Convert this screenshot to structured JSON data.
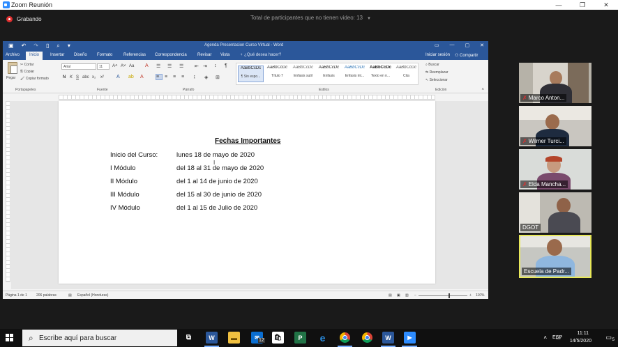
{
  "zoom": {
    "window_title": "Zoom Reunión",
    "recording_label": "Grabando",
    "participants_notice": "Total de participantes que no tienen video: 13",
    "controls": {
      "minimize": "—",
      "restore": "❐",
      "close": "✕"
    }
  },
  "word": {
    "title": "Agenda Presentacion Curso Virtual - Word",
    "tabs": [
      "Archivo",
      "Inicio",
      "Insertar",
      "Diseño",
      "Formato",
      "Referencias",
      "Correspondencia",
      "Revisar",
      "Vista"
    ],
    "active_tab": "Inicio",
    "tell_me": "¿Qué desea hacer?",
    "sign_in": "Iniciar sesión",
    "share": "Compartir",
    "ribbon": {
      "paste": "Pegar",
      "cut": "Cortar",
      "copy": "Copiar",
      "format_painter": "Copiar formato",
      "group_clipboard": "Portapapeles",
      "font_name": "Arial",
      "font_size": "11",
      "group_font": "Fuente",
      "group_paragraph": "Párrafo",
      "group_styles": "Estilos",
      "group_editing": "Edición",
      "find": "Buscar",
      "replace": "Reemplazar",
      "select": "Seleccionar",
      "styles": [
        {
          "sample": "AaBbCcDc",
          "name": "¶ Sin espo..."
        },
        {
          "sample": "AaBbCcDc",
          "name": "Título 7"
        },
        {
          "sample": "AaBbCcDc",
          "name": "Énfasis sutil"
        },
        {
          "sample": "AaBbCcDc",
          "name": "Énfasis"
        },
        {
          "sample": "AaBbCcDc",
          "name": "Énfasis int..."
        },
        {
          "sample": "AaBbCcDc",
          "name": "Texto en n..."
        },
        {
          "sample": "AaBbCcDc",
          "name": "Cita"
        }
      ]
    },
    "document": {
      "heading": "Fechas Importantes",
      "rows": [
        {
          "label": "Inicio del Curso:",
          "value": "lunes 18 de mayo de 2020"
        },
        {
          "label": "I Módulo",
          "value": "del 18 al 31 de mayo de 2020"
        },
        {
          "label": "II Módulo",
          "value": "del 1 al 14 de junio de 2020"
        },
        {
          "label": "III Módulo",
          "value": "del 15 al 30 de junio de 2020"
        },
        {
          "label": "IV Módulo",
          "value": "del 1 al 15 de Julio de 2020"
        }
      ]
    },
    "status": {
      "page": "Página 1 de 1",
      "words": "206 palabras",
      "language": "Español (Honduras)",
      "zoom": "110%"
    }
  },
  "participants": [
    {
      "name": "Marco Anton...",
      "muted": true,
      "active": false
    },
    {
      "name": "Wilmer Turci...",
      "muted": true,
      "active": false
    },
    {
      "name": "Elda Mancha...",
      "muted": true,
      "active": false
    },
    {
      "name": "DGOT",
      "muted": false,
      "active": false
    },
    {
      "name": "Escuela de Padr...",
      "muted": false,
      "active": true
    }
  ],
  "taskbar": {
    "search_placeholder": "Escribe aquí para buscar",
    "mail_badge": "12",
    "language": "ESP",
    "time": "11:11",
    "date": "14/5/2020",
    "notification_count": "5"
  },
  "colors": {
    "word_blue": "#2b579a",
    "zoom_bg": "#1a1a1a",
    "active_speaker": "#e8e85a",
    "record_red": "#e02f2f"
  }
}
